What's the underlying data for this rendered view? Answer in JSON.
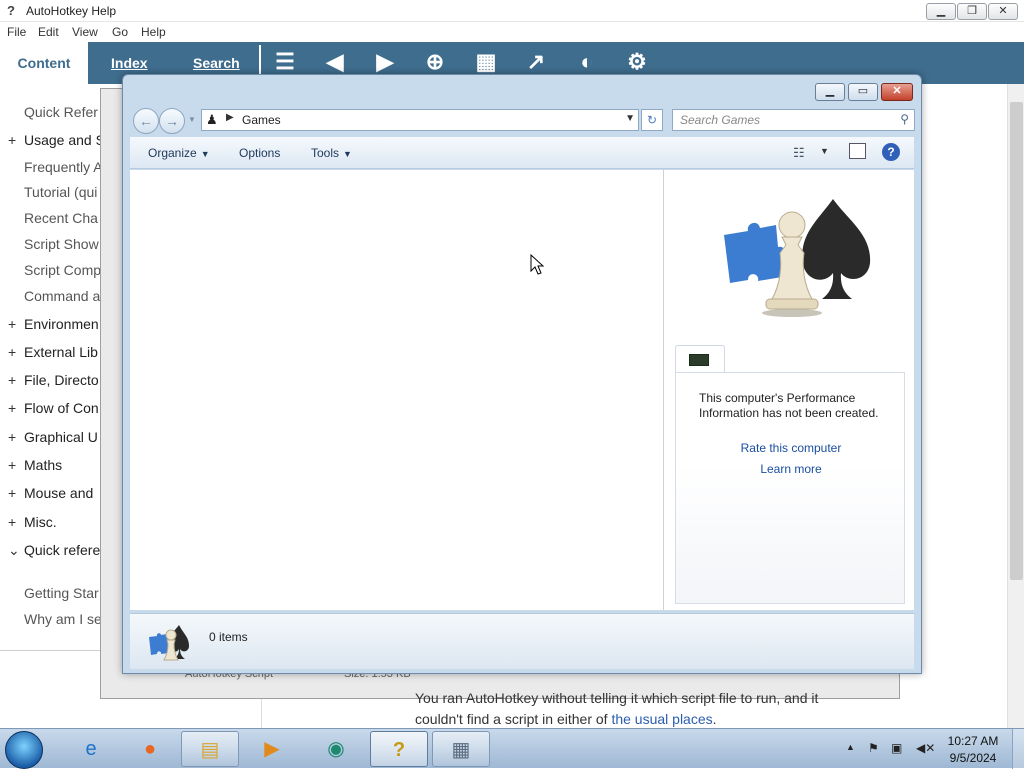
{
  "ahk": {
    "title": "AutoHotkey Help",
    "menu": [
      "File",
      "Edit",
      "View",
      "Go",
      "Help"
    ],
    "tabs": [
      "Content",
      "Index",
      "Search"
    ],
    "sidebar": [
      {
        "prefix": "",
        "label": "Quick Refer"
      },
      {
        "prefix": "+",
        "label": "Usage and S"
      },
      {
        "prefix": "",
        "label": "Frequently A"
      },
      {
        "prefix": "",
        "label": "Tutorial (qui"
      },
      {
        "prefix": "",
        "label": "Recent Cha"
      },
      {
        "prefix": "",
        "label": "Script Show"
      },
      {
        "prefix": "",
        "label": "Script Comp"
      },
      {
        "prefix": "",
        "label": "Command a"
      },
      {
        "prefix": "+",
        "label": "Environmen"
      },
      {
        "prefix": "+",
        "label": "External Lib"
      },
      {
        "prefix": "+",
        "label": "File, Directo"
      },
      {
        "prefix": "+",
        "label": "Flow of Con"
      },
      {
        "prefix": "+",
        "label": "Graphical U"
      },
      {
        "prefix": "+",
        "label": "Maths"
      },
      {
        "prefix": "+",
        "label": "Mouse and"
      },
      {
        "prefix": "+",
        "label": "Misc."
      },
      {
        "prefix": "⌄",
        "label": "Quick refere"
      },
      {
        "prefix": "",
        "label": "Getting Star"
      },
      {
        "prefix": "",
        "label": "Why am I se"
      }
    ],
    "body_line1_a": "You ran AutoHotkey without ",
    "body_line1_link": "telling it",
    "body_line1_b": " which script file to run, and it",
    "body_line2_a": "couldn't find a script in either of ",
    "body_line2_link": "the usual places",
    "body_line2_b": ".",
    "behind_file_name": "AutoHotkey Script",
    "behind_file_size": "Size: 1.53 KB"
  },
  "games": {
    "address": "Games",
    "search_placeholder": "Search Games",
    "commands": {
      "organize": "Organize",
      "options": "Options",
      "tools": "Tools"
    },
    "perf_text": "This computer's Performance Information has not been created.",
    "rate_link": "Rate this computer",
    "learn_link": "Learn more",
    "item_count": "0 items"
  },
  "taskbar": {
    "time": "10:27 AM",
    "date": "9/5/2024"
  }
}
